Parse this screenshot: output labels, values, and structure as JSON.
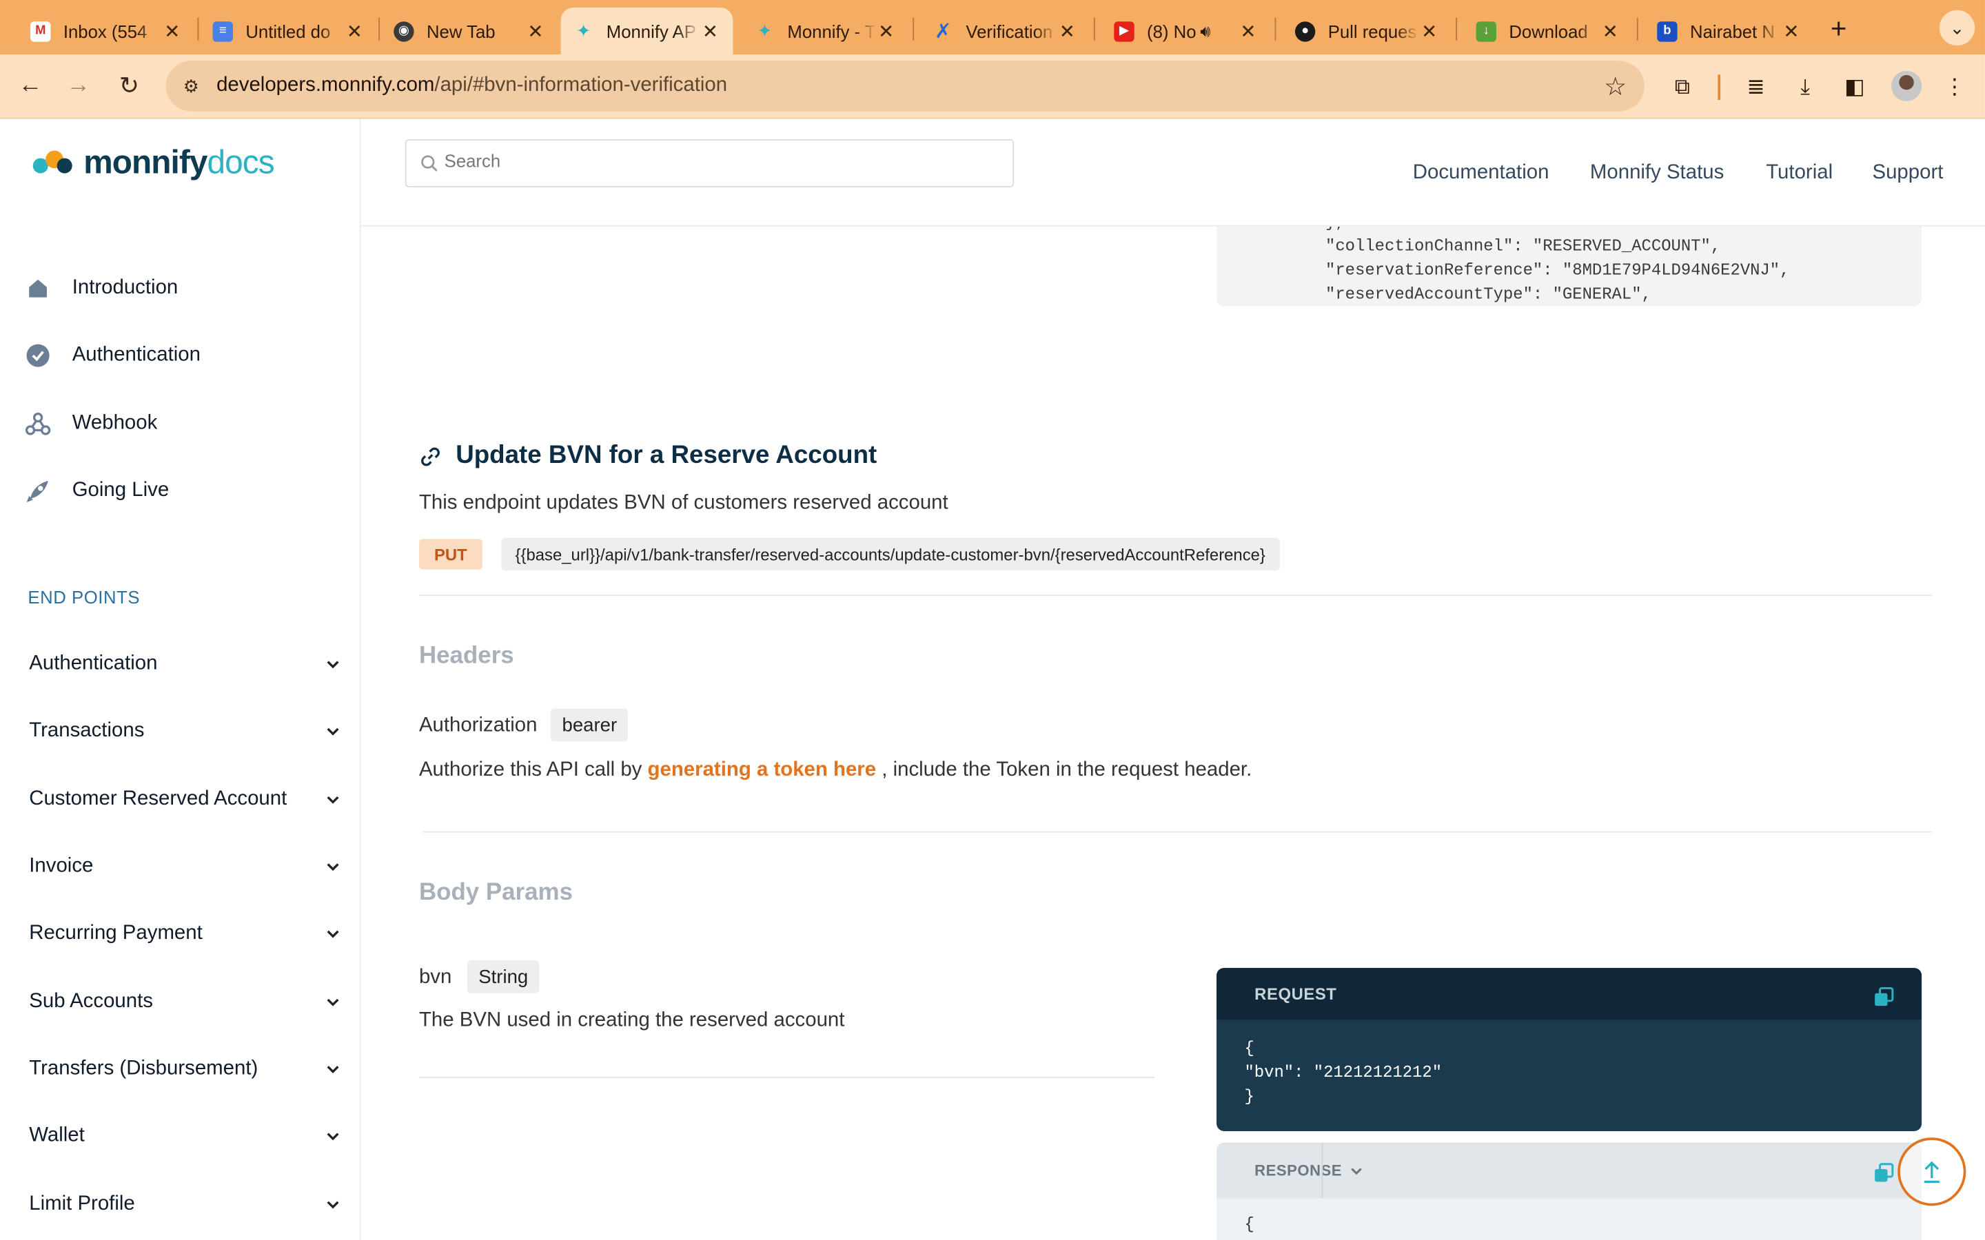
{
  "browser": {
    "tabs": [
      {
        "title": "Inbox (554",
        "icon": "gmail-icon"
      },
      {
        "title": "Untitled do",
        "icon": "google-docs-icon"
      },
      {
        "title": "New Tab",
        "icon": "chrome-icon"
      },
      {
        "title": "Monnify AP",
        "icon": "monnify-icon"
      },
      {
        "title": "Monnify - T",
        "icon": "monnify-icon"
      },
      {
        "title": "Verification",
        "icon": "confluence-icon"
      },
      {
        "title": "(8) No",
        "icon": "youtube-icon"
      },
      {
        "title": "Pull reques",
        "icon": "github-icon"
      },
      {
        "title": "Download",
        "icon": "download-site-icon"
      },
      {
        "title": "Nairabet N",
        "icon": "nairabet-icon"
      }
    ],
    "active_tab_index": 3,
    "url_domain": "developers.monnify.com",
    "url_path": "/api/#bvn-information-verification",
    "colors": {
      "tabbar": "#f4ad63",
      "toolbar": "#fde0c0"
    }
  },
  "brand": {
    "name": "monnify",
    "suffix": "docs"
  },
  "sidebar": {
    "main_items": [
      {
        "label": "Introduction",
        "icon": "home-icon"
      },
      {
        "label": "Authentication",
        "icon": "check-circle-icon"
      },
      {
        "label": "Webhook",
        "icon": "webhook-icon"
      },
      {
        "label": "Going Live",
        "icon": "rocket-icon"
      }
    ],
    "endpoints_heading": "END POINTS",
    "endpoint_groups": [
      "Authentication",
      "Transactions",
      "Customer Reserved Account",
      "Invoice",
      "Recurring Payment",
      "Sub Accounts",
      "Transfers (Disbursement)",
      "Wallet",
      "Limit Profile"
    ]
  },
  "header": {
    "search_placeholder": "Search",
    "nav": [
      "Documentation",
      "Monnify Status",
      "Tutorial",
      "Support"
    ]
  },
  "content": {
    "previous_code_tail": [
      "},",
      "\"collectionChannel\": \"RESERVED_ACCOUNT\",",
      "\"reservationReference\": \"8MD1E79P4LD94N6E2VNJ\",",
      "\"reservedAccountType\": \"GENERAL\","
    ],
    "section_title": "Update BVN for a Reserve Account",
    "section_description": "This endpoint updates BVN of customers reserved account",
    "method": "PUT",
    "endpoint": "{{base_url}}/api/v1/bank-transfer/reserved-accounts/update-customer-bvn/{reservedAccountReference}",
    "headers_title": "Headers",
    "header_param": {
      "name": "Authorization",
      "type": "bearer"
    },
    "auth_text_before": "Authorize this API call by",
    "auth_link": "generating a token here",
    "auth_text_after": ", include the Token in the request header.",
    "body_title": "Body Params",
    "body_param": {
      "name": "bvn",
      "type": "String",
      "description": "The BVN used in creating the reserved account"
    },
    "request": {
      "label": "REQUEST",
      "code": [
        "{",
        "\"bvn\": \"21212121212\"",
        "}"
      ]
    },
    "response": {
      "label": "RESPONSE",
      "code_first_line": "{"
    }
  }
}
